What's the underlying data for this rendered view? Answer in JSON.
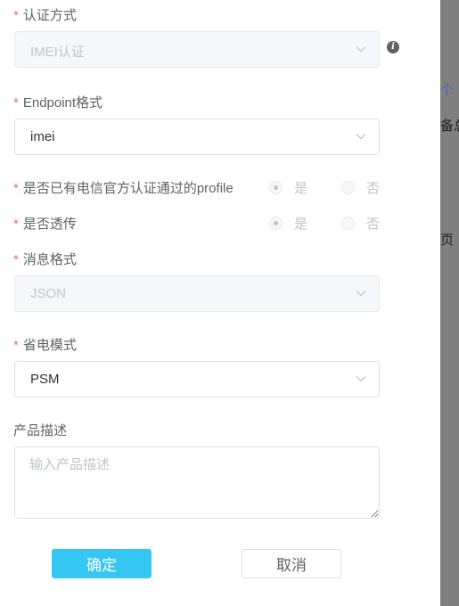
{
  "form": {
    "auth_method": {
      "required_mark": "*",
      "label": "认证方式",
      "value": "IMEI认证"
    },
    "endpoint_format": {
      "required_mark": "*",
      "label": "Endpoint格式",
      "value": "imei"
    },
    "has_profile": {
      "required_mark": "*",
      "label": "是否已有电信官方认证通过的profile",
      "options": [
        "是",
        "否"
      ],
      "selected": "是"
    },
    "passthrough": {
      "required_mark": "*",
      "label": "是否透传",
      "options": [
        "是",
        "否"
      ],
      "selected": "是"
    },
    "message_format": {
      "required_mark": "*",
      "label": "消息格式",
      "value": "JSON"
    },
    "power_mode": {
      "required_mark": "*",
      "label": "省电模式",
      "value": "PSM"
    },
    "description": {
      "label": "产品描述",
      "placeholder": "输入产品描述",
      "value": ""
    }
  },
  "buttons": {
    "confirm": "确定",
    "cancel": "取消"
  },
  "background_fragments": {
    "frag1": "个",
    "frag2": "备总",
    "frag3": "页"
  },
  "icons": {
    "info": "info-circle-icon",
    "select": "chevron-down-icon"
  },
  "colors": {
    "primary": "#36c6f4",
    "required": "#f56c6c",
    "overlay": "#7f7f7f"
  }
}
